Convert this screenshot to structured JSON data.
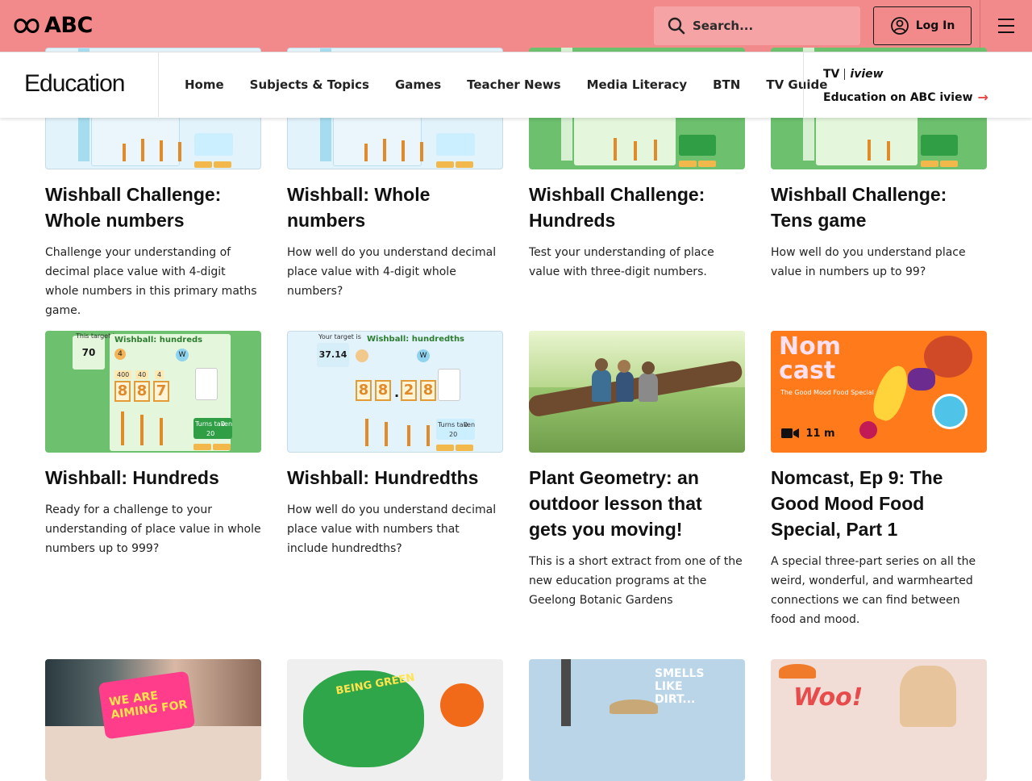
{
  "header": {
    "brand": "ABC",
    "search": {
      "placeholder": "Search..."
    },
    "login_label": "Log In"
  },
  "nav": {
    "section_title": "Education",
    "links": [
      "Home",
      "Subjects & Topics",
      "Games",
      "Teacher News",
      "Media Literacy",
      "BTN",
      "TV Guide"
    ],
    "promo": {
      "logo_tv": "TV",
      "logo_iview": "iview",
      "label": "Education on ABC iview"
    }
  },
  "cards": [
    {
      "title": "Wishball Challenge: Whole numbers",
      "desc": "Challenge your understanding of decimal place value with 4-digit whole numbers in this primary maths game.",
      "thumb": "blue"
    },
    {
      "title": "Wishball: Whole numbers",
      "desc": "How well do you understand decimal place value with 4-digit whole numbers?",
      "thumb": "blue"
    },
    {
      "title": "Wishball Challenge: Hundreds",
      "desc": "Test your understanding of place value with three-digit numbers.",
      "thumb": "green"
    },
    {
      "title": "Wishball Challenge: Tens game",
      "desc": "How well do you understand place value in numbers up to 99?",
      "thumb": "green"
    },
    {
      "title": "Wishball: Hundreds",
      "desc": "Ready for a challenge to your understanding of place value in whole numbers up to 999?",
      "thumb": "green",
      "thumb_text": {
        "heading": "Wishball: hundreds",
        "target_label": "This target is",
        "target": "70",
        "spinner": "4",
        "wish": "W",
        "places": [
          "400",
          "40",
          "4"
        ],
        "digits": [
          "8",
          "8",
          "7"
        ],
        "turns_label": "Turns taken",
        "turns": "0",
        "limit": "20"
      }
    },
    {
      "title": "Wishball: Hundredths",
      "desc": "How well do you understand decimal place value with numbers that include hundredths?",
      "thumb": "blue",
      "thumb_text": {
        "heading": "Wishball: hundredths",
        "target_label": "Your target is",
        "target": "37.14",
        "wish": "W",
        "digits": [
          "8",
          "8",
          ".",
          "2",
          "8"
        ],
        "turns_label": "Turns taken",
        "turns": "0",
        "limit": "20"
      }
    },
    {
      "title": "Plant Geometry: an outdoor lesson that gets you moving!",
      "desc": "This is a short extract from one of the new education programs at the Geelong Botanic Gardens",
      "thumb": "photo"
    },
    {
      "title": "Nomcast, Ep 9: The Good Mood Food Special, Part 1",
      "desc": "A special three-part series on all the weird, wonderful, and warmhearted connections we can find between food and mood.",
      "thumb": "orange",
      "badge": "11 m",
      "thumb_text": {
        "line1": "Nom",
        "line2": "cast",
        "sub": "The Good Mood Food Special"
      }
    }
  ],
  "bottom_row": [
    {
      "overlay": "WE ARE AIMING FOR"
    },
    {
      "overlay": "BEING GREEN"
    },
    {
      "overlay": "SMELLS LIKE DIRT..."
    },
    {
      "overlay": "Woo!"
    }
  ],
  "colors": {
    "header_bg": "#f28a8c",
    "accent": "#e64646",
    "badge": "#ff7a1a"
  }
}
